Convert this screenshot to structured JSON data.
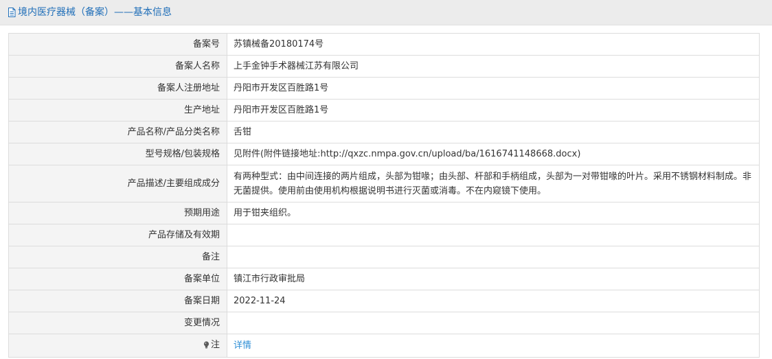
{
  "header": {
    "title": "境内医疗器械（备案）——基本信息",
    "icon": "document-icon"
  },
  "rows": [
    {
      "label": "备案号",
      "value": "苏镇械备20180174号"
    },
    {
      "label": "备案人名称",
      "value": "上手金钟手术器械江苏有限公司"
    },
    {
      "label": "备案人注册地址",
      "value": "丹阳市开发区百胜路1号"
    },
    {
      "label": "生产地址",
      "value": "丹阳市开发区百胜路1号"
    },
    {
      "label": "产品名称/产品分类名称",
      "value": "舌钳"
    },
    {
      "label": "型号规格/包装规格",
      "value": "见附件(附件链接地址:http://qxzc.nmpa.gov.cn/upload/ba/1616741148668.docx)"
    },
    {
      "label": "产品描述/主要组成成分",
      "value": "有两种型式：由中间连接的两片组成，头部为钳喙；由头部、杆部和手柄组成，头部为一对带钳喙的叶片。采用不锈钢材料制成。非无菌提供。使用前由使用机构根据说明书进行灭菌或消毒。不在内窥镜下使用。"
    },
    {
      "label": "预期用途",
      "value": "用于钳夹组织。"
    },
    {
      "label": "产品存储及有效期",
      "value": ""
    },
    {
      "label": "备注",
      "value": ""
    },
    {
      "label": "备案单位",
      "value": "镇江市行政审批局"
    },
    {
      "label": "备案日期",
      "value": "2022-11-24"
    },
    {
      "label": "变更情况",
      "value": ""
    }
  ],
  "note": {
    "label": "注",
    "icon": "lightbulb-icon",
    "link_text": "详情",
    "link_color": "#2f8fd6"
  },
  "colors": {
    "header_bg": "#ececec",
    "title_color": "#1f6eb8",
    "label_bg": "#f4f4f4",
    "border": "#dcdcdc"
  }
}
